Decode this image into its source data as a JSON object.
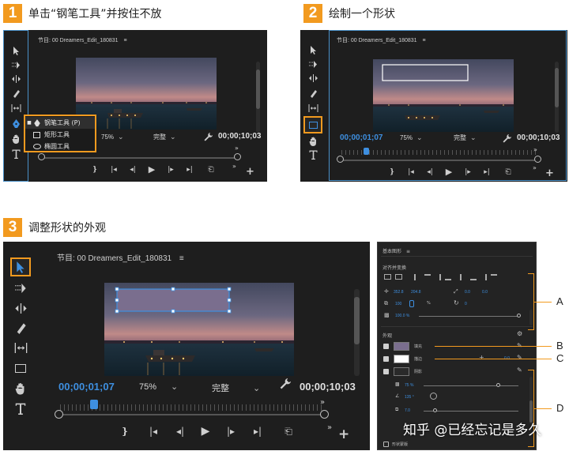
{
  "steps": [
    {
      "num": "1",
      "title": "单击“钢笔工具”并按住不放"
    },
    {
      "num": "2",
      "title": "绘制一个形状"
    },
    {
      "num": "3",
      "title": "调整形状的外观"
    }
  ],
  "monitor": {
    "title": "节目: 00 Dreamers_Edit_180831",
    "menu_icon": "≡",
    "zoom": "75%",
    "quality": "完整",
    "duration": "00;00;10;03",
    "playhead_time": "00;00;01;07"
  },
  "tool_popup": {
    "items": [
      {
        "label": "钢笔工具 (P)",
        "icon": "pen-icon"
      },
      {
        "label": "矩形工具",
        "icon": "rectangle-icon"
      },
      {
        "label": "椭圆工具",
        "icon": "ellipse-icon"
      }
    ]
  },
  "essential_graphics": {
    "title": "基本图形",
    "menu_icon": "≡",
    "align_section": "对齐并变换",
    "position": [
      "352.8",
      "204.8"
    ],
    "anchor": [
      "0.0",
      "0.0"
    ],
    "scale": "100",
    "scale_lock": "%",
    "rotation": "0",
    "opacity": "100.0 %",
    "appearance_section": "外观",
    "fill_label": "填充",
    "stroke_label": "描边",
    "stroke_width": "0.0",
    "shadow_label": "阴影",
    "shadow_opacity": "75 %",
    "shadow_angle": "135 °",
    "shadow_distance": "7.0",
    "mask_label": "形状蒙版",
    "fill_color": "#7a6e8e",
    "stroke_color": "#ffffff"
  },
  "callouts": [
    "A",
    "B",
    "C",
    "D"
  ],
  "watermark": "知乎 @已经忘记是多久",
  "colors": {
    "accent": "#f29a1f",
    "timecode": "#3e8fe0",
    "panel": "#1e1e1e"
  }
}
